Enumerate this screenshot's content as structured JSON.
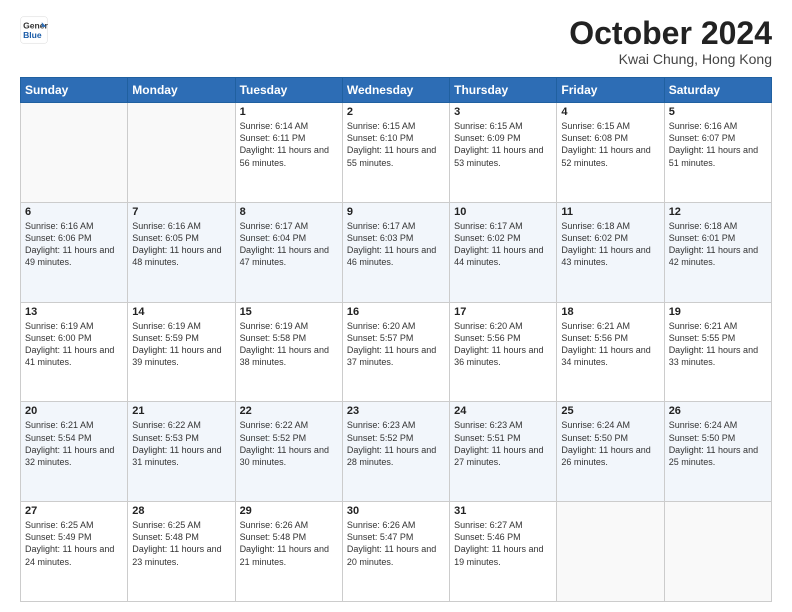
{
  "header": {
    "logo_line1": "General",
    "logo_line2": "Blue",
    "month": "October 2024",
    "location": "Kwai Chung, Hong Kong"
  },
  "weekdays": [
    "Sunday",
    "Monday",
    "Tuesday",
    "Wednesday",
    "Thursday",
    "Friday",
    "Saturday"
  ],
  "weeks": [
    [
      {
        "day": "",
        "info": ""
      },
      {
        "day": "",
        "info": ""
      },
      {
        "day": "1",
        "info": "Sunrise: 6:14 AM\nSunset: 6:11 PM\nDaylight: 11 hours and 56 minutes."
      },
      {
        "day": "2",
        "info": "Sunrise: 6:15 AM\nSunset: 6:10 PM\nDaylight: 11 hours and 55 minutes."
      },
      {
        "day": "3",
        "info": "Sunrise: 6:15 AM\nSunset: 6:09 PM\nDaylight: 11 hours and 53 minutes."
      },
      {
        "day": "4",
        "info": "Sunrise: 6:15 AM\nSunset: 6:08 PM\nDaylight: 11 hours and 52 minutes."
      },
      {
        "day": "5",
        "info": "Sunrise: 6:16 AM\nSunset: 6:07 PM\nDaylight: 11 hours and 51 minutes."
      }
    ],
    [
      {
        "day": "6",
        "info": "Sunrise: 6:16 AM\nSunset: 6:06 PM\nDaylight: 11 hours and 49 minutes."
      },
      {
        "day": "7",
        "info": "Sunrise: 6:16 AM\nSunset: 6:05 PM\nDaylight: 11 hours and 48 minutes."
      },
      {
        "day": "8",
        "info": "Sunrise: 6:17 AM\nSunset: 6:04 PM\nDaylight: 11 hours and 47 minutes."
      },
      {
        "day": "9",
        "info": "Sunrise: 6:17 AM\nSunset: 6:03 PM\nDaylight: 11 hours and 46 minutes."
      },
      {
        "day": "10",
        "info": "Sunrise: 6:17 AM\nSunset: 6:02 PM\nDaylight: 11 hours and 44 minutes."
      },
      {
        "day": "11",
        "info": "Sunrise: 6:18 AM\nSunset: 6:02 PM\nDaylight: 11 hours and 43 minutes."
      },
      {
        "day": "12",
        "info": "Sunrise: 6:18 AM\nSunset: 6:01 PM\nDaylight: 11 hours and 42 minutes."
      }
    ],
    [
      {
        "day": "13",
        "info": "Sunrise: 6:19 AM\nSunset: 6:00 PM\nDaylight: 11 hours and 41 minutes."
      },
      {
        "day": "14",
        "info": "Sunrise: 6:19 AM\nSunset: 5:59 PM\nDaylight: 11 hours and 39 minutes."
      },
      {
        "day": "15",
        "info": "Sunrise: 6:19 AM\nSunset: 5:58 PM\nDaylight: 11 hours and 38 minutes."
      },
      {
        "day": "16",
        "info": "Sunrise: 6:20 AM\nSunset: 5:57 PM\nDaylight: 11 hours and 37 minutes."
      },
      {
        "day": "17",
        "info": "Sunrise: 6:20 AM\nSunset: 5:56 PM\nDaylight: 11 hours and 36 minutes."
      },
      {
        "day": "18",
        "info": "Sunrise: 6:21 AM\nSunset: 5:56 PM\nDaylight: 11 hours and 34 minutes."
      },
      {
        "day": "19",
        "info": "Sunrise: 6:21 AM\nSunset: 5:55 PM\nDaylight: 11 hours and 33 minutes."
      }
    ],
    [
      {
        "day": "20",
        "info": "Sunrise: 6:21 AM\nSunset: 5:54 PM\nDaylight: 11 hours and 32 minutes."
      },
      {
        "day": "21",
        "info": "Sunrise: 6:22 AM\nSunset: 5:53 PM\nDaylight: 11 hours and 31 minutes."
      },
      {
        "day": "22",
        "info": "Sunrise: 6:22 AM\nSunset: 5:52 PM\nDaylight: 11 hours and 30 minutes."
      },
      {
        "day": "23",
        "info": "Sunrise: 6:23 AM\nSunset: 5:52 PM\nDaylight: 11 hours and 28 minutes."
      },
      {
        "day": "24",
        "info": "Sunrise: 6:23 AM\nSunset: 5:51 PM\nDaylight: 11 hours and 27 minutes."
      },
      {
        "day": "25",
        "info": "Sunrise: 6:24 AM\nSunset: 5:50 PM\nDaylight: 11 hours and 26 minutes."
      },
      {
        "day": "26",
        "info": "Sunrise: 6:24 AM\nSunset: 5:50 PM\nDaylight: 11 hours and 25 minutes."
      }
    ],
    [
      {
        "day": "27",
        "info": "Sunrise: 6:25 AM\nSunset: 5:49 PM\nDaylight: 11 hours and 24 minutes."
      },
      {
        "day": "28",
        "info": "Sunrise: 6:25 AM\nSunset: 5:48 PM\nDaylight: 11 hours and 23 minutes."
      },
      {
        "day": "29",
        "info": "Sunrise: 6:26 AM\nSunset: 5:48 PM\nDaylight: 11 hours and 21 minutes."
      },
      {
        "day": "30",
        "info": "Sunrise: 6:26 AM\nSunset: 5:47 PM\nDaylight: 11 hours and 20 minutes."
      },
      {
        "day": "31",
        "info": "Sunrise: 6:27 AM\nSunset: 5:46 PM\nDaylight: 11 hours and 19 minutes."
      },
      {
        "day": "",
        "info": ""
      },
      {
        "day": "",
        "info": ""
      }
    ]
  ]
}
